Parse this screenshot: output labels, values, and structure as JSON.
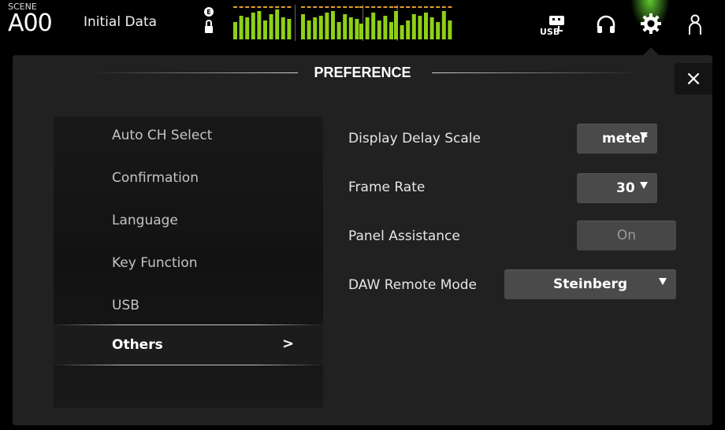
{
  "topbar": {
    "scene_label": "SCENE",
    "scene_number": "A00",
    "scene_name": "Initial Data",
    "meter_levels": [
      0.55,
      0.75,
      0.7,
      0.85,
      0.9,
      0.6,
      0.8,
      0.95,
      0.7,
      0.65,
      0.8,
      0.6,
      0.7,
      0.75,
      0.85,
      0.9,
      0.55,
      0.8,
      0.7,
      0.65,
      0.5,
      0.7,
      0.85,
      0.6,
      0.75,
      0.55,
      0.9,
      0.45,
      0.6,
      0.8,
      0.75,
      0.85,
      0.7,
      0.55,
      0.9,
      0.6
    ],
    "icons": [
      "usb-icon",
      "headphones-icon",
      "gear-icon",
      "user-icon"
    ]
  },
  "dialog": {
    "title": "PREFERENCE",
    "close_label": "×"
  },
  "sidebar": {
    "items": [
      {
        "label": "Auto CH Select"
      },
      {
        "label": "Confirmation"
      },
      {
        "label": "Language"
      },
      {
        "label": "Key Function"
      },
      {
        "label": "USB"
      },
      {
        "label": "Others"
      }
    ],
    "selected_arrow": ">"
  },
  "settings": {
    "display_delay_scale": {
      "label": "Display Delay Scale",
      "value": "meter"
    },
    "frame_rate": {
      "label": "Frame Rate",
      "value": "30"
    },
    "panel_assistance": {
      "label": "Panel Assistance",
      "value": "On"
    },
    "daw_remote_mode": {
      "label": "DAW Remote Mode",
      "value": "Steinberg"
    }
  },
  "colors": {
    "meter_green": "#8fd016",
    "meter_peak": "#e0a030",
    "panel_bg": "#212121",
    "button_bg": "#4a4a4a"
  }
}
